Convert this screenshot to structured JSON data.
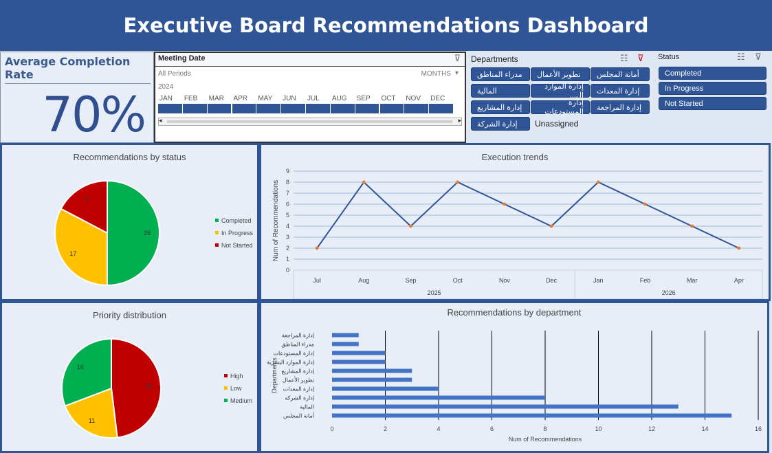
{
  "header": {
    "title": "Executive Board Recommendations Dashboard"
  },
  "kpi": {
    "title": "Average Completion Rate",
    "value": "70%"
  },
  "timeline": {
    "title": "Meeting Date",
    "period_label": "All Periods",
    "level_label": "MONTHS",
    "year": "2024",
    "months": [
      "JAN",
      "FEB",
      "MAR",
      "APR",
      "MAY",
      "JUN",
      "JUL",
      "AUG",
      "SEP",
      "OCT",
      "NOV",
      "DEC"
    ]
  },
  "departments_slicer": {
    "title": "Departments",
    "items": [
      "أمانة المجلس",
      "تطوير الأعمال",
      "مدراء المناطق",
      "إدارة المعدات",
      "إدارة الموارد ال...",
      "المالية",
      "إدارة المراجعة",
      "إدارة المستودعات",
      "إدارة المشاريع",
      "إدارة الشركة",
      "Unassigned"
    ]
  },
  "status_slicer": {
    "title": "Status",
    "items": [
      "Completed",
      "In Progress",
      "Not Started"
    ]
  },
  "colors": {
    "brand": "#2f5597",
    "green": "#00b050",
    "yellow": "#ffc000",
    "red": "#c00000",
    "line": "#2f5597",
    "marker": "#ed7d31"
  },
  "chart_data": [
    {
      "type": "pie",
      "title": "Recommendations by status",
      "categories": [
        "Completed",
        "In Progress",
        "Not Started"
      ],
      "values": [
        26,
        17,
        9
      ],
      "legend": "right"
    },
    {
      "type": "line",
      "title": "Execution trends",
      "ylabel": "Num of Recommendations",
      "x": [
        "Jul",
        "Aug",
        "Sep",
        "Oct",
        "Nov",
        "Dec",
        "Jan",
        "Feb",
        "Mar",
        "Apr"
      ],
      "x_groups": [
        {
          "label": "2025",
          "count": 6
        },
        {
          "label": "2026",
          "count": 4
        }
      ],
      "values": [
        2,
        8,
        4,
        8,
        6,
        4,
        8,
        6,
        4,
        2
      ],
      "ylim": [
        0,
        9
      ],
      "yticks": [
        "0",
        "1",
        "2",
        "3",
        "4",
        "5",
        "6",
        "7",
        "8",
        "9"
      ],
      "grid": true
    },
    {
      "type": "pie",
      "title": "Priority distribution",
      "categories": [
        "High",
        "Low",
        "Medium"
      ],
      "values": [
        25,
        11,
        16
      ],
      "legend": "right"
    },
    {
      "type": "bar",
      "title": "Recommendations by department",
      "orientation": "horizontal",
      "ylabel": "Departments",
      "xlabel": "Num of Recommendations",
      "categories": [
        "إدارة المراجعة",
        "مدراء المناطق",
        "إدارة المستودعات",
        "إدارة الموارد البشرية",
        "إدارة المشاريع",
        "تطوير الأعمال",
        "إدارة المعدات",
        "إدارة الشركة",
        "المالية",
        "أمانة المجلس"
      ],
      "values": [
        1,
        1,
        2,
        2,
        3,
        3,
        4,
        8,
        13,
        15
      ],
      "xlim": [
        0,
        16
      ],
      "xticks": [
        "0",
        "2",
        "4",
        "6",
        "8",
        "10",
        "12",
        "14",
        "16"
      ],
      "grid": true
    }
  ]
}
